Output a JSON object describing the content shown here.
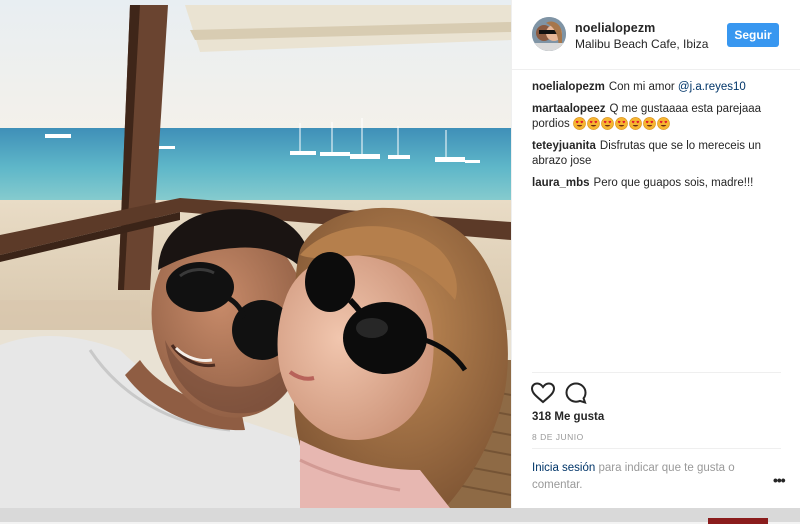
{
  "post": {
    "username": "noelialopezm",
    "location": "Malibu Beach Cafe, Ibiza",
    "follow_label": "Seguir"
  },
  "comments": [
    {
      "user": "noelialopezm",
      "text": "Con mi amor ",
      "mention": "@j.a.reyes10"
    },
    {
      "user": "martaalopeez",
      "text": "Q me gustaaaa esta parejaaa pordios",
      "emoji": "heart-eyes-face",
      "emoji_count": 7
    },
    {
      "user": "teteyjuanita",
      "text": "Disfrutas que se lo mereceis un abrazo jose"
    },
    {
      "user": "laura_mbs",
      "text": "Pero que guapos sois, madre!!!"
    }
  ],
  "actions": {
    "likes": "318 Me gusta",
    "date": "8 DE JUNIO"
  },
  "login": {
    "link": "Inicia sesión",
    "text": " para indicar que te gusta o comentar.",
    "more": "•••"
  },
  "colors": {
    "accent": "#3897f0",
    "link": "#003569",
    "muted": "#999999"
  }
}
